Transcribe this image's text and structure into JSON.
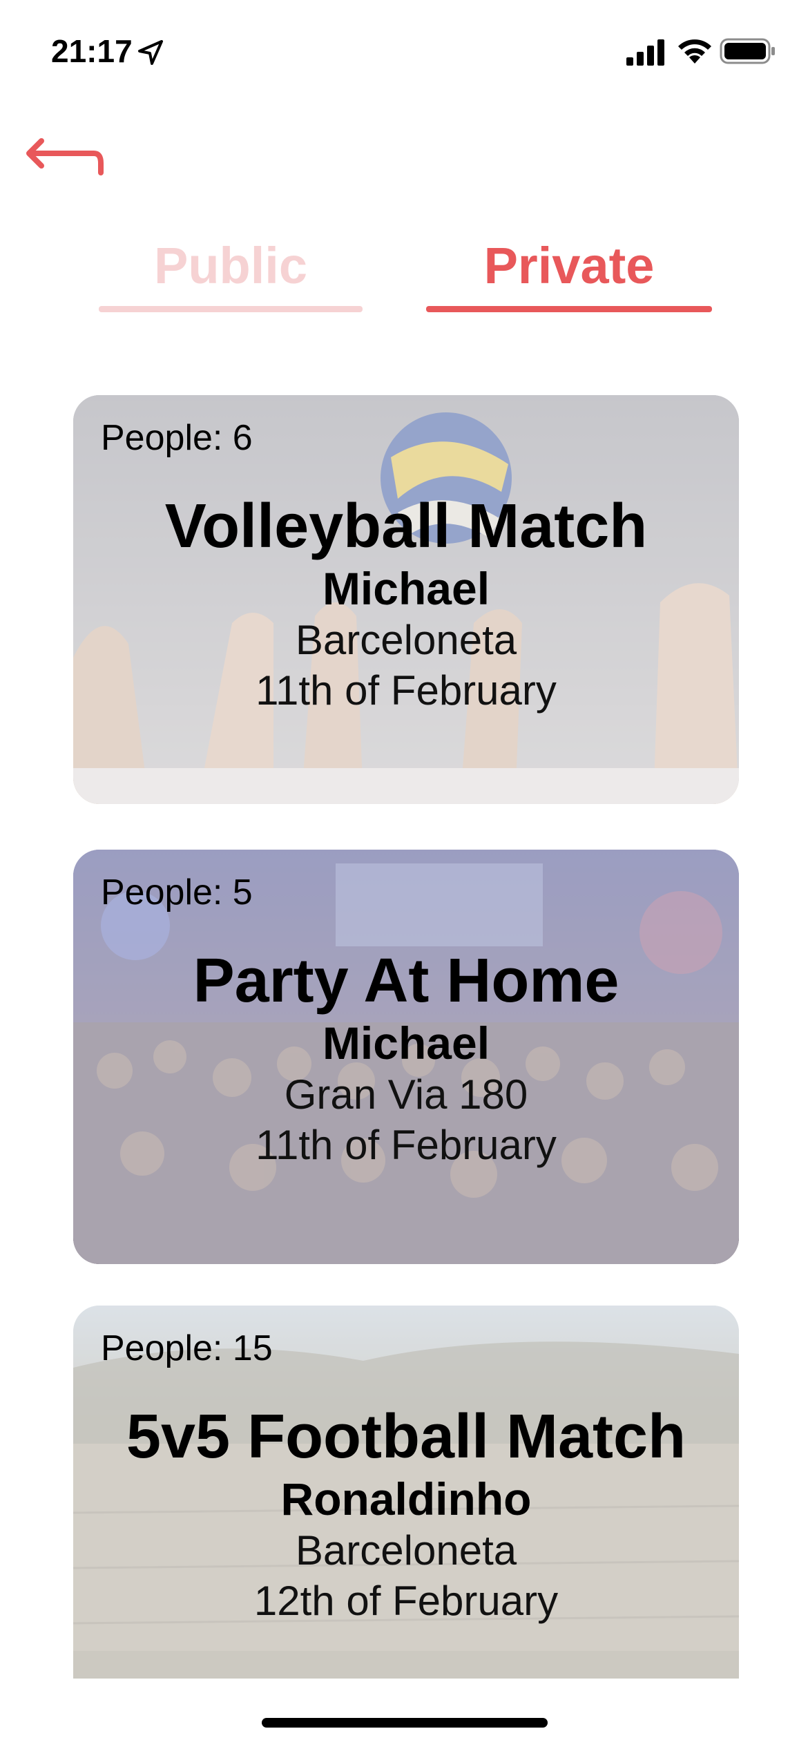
{
  "status_bar": {
    "time": "21:17",
    "location_icon": "location-arrow-icon",
    "signal_icon": "cellular-signal-icon",
    "wifi_icon": "wifi-icon",
    "battery_icon": "battery-icon"
  },
  "nav": {
    "back_icon": "back-arrow-icon"
  },
  "tabs": [
    {
      "label": "Public",
      "active": false
    },
    {
      "label": "Private",
      "active": true
    }
  ],
  "colors": {
    "accent": "#e8585a",
    "accent_faded": "#f6d2d3",
    "card_veil": "#ebebee"
  },
  "events": [
    {
      "people": "People: 6",
      "title": "Volleyball Match",
      "host": "Michael",
      "location": "Barceloneta",
      "date": "11th of February",
      "image_icon": "volleyball-photo"
    },
    {
      "people": "People: 5",
      "title": "Party At Home",
      "host": "Michael",
      "location": "Gran Via 180",
      "date": "11th of February",
      "image_icon": "party-crowd-photo"
    },
    {
      "people": "People: 15",
      "title": "5v5 Football Match",
      "host": "Ronaldinho",
      "location": "Barceloneta",
      "date": "12th of February",
      "image_icon": "field-landscape-photo"
    }
  ]
}
